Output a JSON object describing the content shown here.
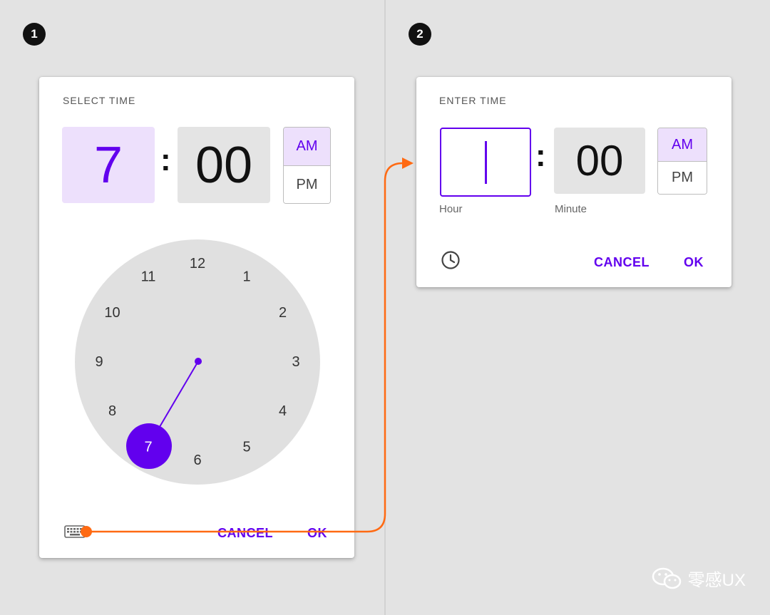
{
  "steps": [
    "1",
    "2"
  ],
  "dial_picker": {
    "title": "SELECT TIME",
    "hour": "7",
    "minute": "00",
    "am_label": "AM",
    "pm_label": "PM",
    "selected_period": "AM",
    "clock_numbers": [
      "12",
      "1",
      "2",
      "3",
      "4",
      "5",
      "6",
      "7",
      "8",
      "9",
      "10",
      "11"
    ],
    "selected_hour": "7",
    "cancel_label": "CANCEL",
    "ok_label": "OK",
    "mode_icon": "keyboard-icon"
  },
  "input_picker": {
    "title": "ENTER TIME",
    "hour_value": "",
    "minute": "00",
    "hour_caption": "Hour",
    "minute_caption": "Minute",
    "am_label": "AM",
    "pm_label": "PM",
    "selected_period": "AM",
    "cancel_label": "CANCEL",
    "ok_label": "OK",
    "mode_icon": "clock-icon"
  },
  "watermark": {
    "text": "零感UX",
    "icon": "wechat-icon"
  },
  "colors": {
    "primary": "#6200ee",
    "primary_light": "#ede0fc",
    "box_gray": "#e4e4e4",
    "dial_gray": "#e0e0e0",
    "arrow": "#ff6a13"
  }
}
